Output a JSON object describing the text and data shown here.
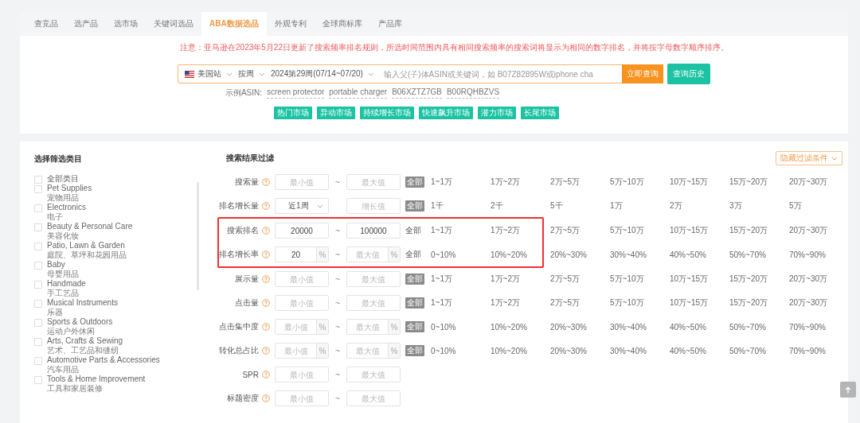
{
  "tabs": [
    {
      "label": "查竞品",
      "selected": false
    },
    {
      "label": "选产品",
      "selected": false
    },
    {
      "label": "选市场",
      "selected": false
    },
    {
      "label": "关键词选品",
      "selected": false
    },
    {
      "label": "ABA数据选品",
      "selected": true
    },
    {
      "label": "外观专利",
      "selected": false
    },
    {
      "label": "全球商标库",
      "selected": false
    },
    {
      "label": "产品库",
      "selected": false
    }
  ],
  "notice": "注意：亚马逊在2023年5月22日更新了搜索频率排名规则，所选时间范围内具有相同搜索频率的搜索词将显示为相同的数字排名，并将按字母数字顺序排序。",
  "search": {
    "site": "美国站",
    "period": "按周",
    "week": "2024第29周(07/14~07/20)",
    "placeholder": "输入父(子)体ASIN或关键词，如 B07Z82895W或iphone cha",
    "button": "立即查询"
  },
  "history_button": "查询历史",
  "examples": {
    "label": "示例ASIN:",
    "items": [
      "screen protector",
      "portable charger",
      "B06XZTZ7GB",
      "B00RQHBZVS"
    ]
  },
  "markets": [
    "热门市场",
    "异动市场",
    "持续增长市场",
    "快速飙升市场",
    "潜力市场",
    "长尾市场"
  ],
  "categories": {
    "title": "选择筛选类目",
    "items": [
      {
        "name": "全部类目",
        "checked": false
      },
      {
        "name": "Pet Supplies",
        "sub": "宠物用品",
        "checked": false
      },
      {
        "name": "Electronics",
        "sub": "电子",
        "checked": false
      },
      {
        "name": "Beauty & Personal Care",
        "sub": "美容化妆",
        "checked": false
      },
      {
        "name": "Patio, Lawn & Garden",
        "sub": "庭院、草坪和花园用品",
        "checked": false
      },
      {
        "name": "Baby",
        "sub": "母婴用品",
        "checked": false
      },
      {
        "name": "Handmade",
        "sub": "手工艺品",
        "checked": false
      },
      {
        "name": "Musical Instruments",
        "sub": "乐器",
        "checked": false
      },
      {
        "name": "Sports & Outdoors",
        "sub": "运动户外休闲",
        "checked": false
      },
      {
        "name": "Arts, Crafts & Sewing",
        "sub": "艺术、工艺品和缝纫",
        "checked": false
      },
      {
        "name": "Automotive Parts & Accessories",
        "sub": "汽车用品",
        "checked": false
      },
      {
        "name": "Tools & Home Improvement",
        "sub": "工具和家居装修",
        "checked": false
      }
    ]
  },
  "filters": {
    "title": "搜索结果过滤",
    "toggle": "隐藏过滤条件",
    "rows": [
      {
        "label": "搜索量",
        "kind": "range",
        "separator": "~",
        "min": {
          "placeholder": "最小值"
        },
        "max": {
          "placeholder": "最大值"
        },
        "all": "全部",
        "all_selected": true,
        "highlighted": false,
        "options": [
          "1~1万",
          "1万~2万",
          "2万~5万",
          "5万~10万",
          "10万~15万",
          "15万~20万",
          "20万~30万"
        ]
      },
      {
        "label": "排名增长量",
        "kind": "select",
        "select": "近1周",
        "max": {
          "placeholder": "增长值"
        },
        "all": "全部",
        "all_selected": true,
        "highlighted": false,
        "options": [
          "1千",
          "2千",
          "5千",
          "1万",
          "2万",
          "3万",
          "5万"
        ]
      },
      {
        "label": "搜索排名",
        "kind": "range",
        "separator": "~",
        "min": {
          "value": "20000"
        },
        "max": {
          "value": "100000"
        },
        "all": "全部",
        "all_selected": false,
        "highlighted": true,
        "options": [
          "1~1万",
          "1万~2万",
          "2万~5万",
          "5万~10万",
          "10万~15万",
          "15万~20万",
          "20万~30万"
        ]
      },
      {
        "label": "排名增长率",
        "kind": "percent",
        "separator": "~",
        "unit": "%",
        "min": {
          "value": "20"
        },
        "max": {
          "placeholder": "最大值"
        },
        "all": "全部",
        "all_selected": false,
        "highlighted": true,
        "options": [
          "0~10%",
          "10%~20%",
          "20%~30%",
          "30%~40%",
          "40%~50%",
          "50%~70%",
          "70%~90%"
        ]
      },
      {
        "label": "展示量",
        "kind": "range",
        "separator": "~",
        "min": {
          "placeholder": "最小值"
        },
        "max": {
          "placeholder": "最大值"
        },
        "all": "全部",
        "all_selected": true,
        "highlighted": false,
        "options": [
          "1~1万",
          "1万~2万",
          "2万~5万",
          "5万~10万",
          "10万~15万",
          "15万~20万",
          "20万~30万"
        ]
      },
      {
        "label": "点击量",
        "kind": "range",
        "separator": "~",
        "min": {
          "placeholder": "最小值"
        },
        "max": {
          "placeholder": "最大值"
        },
        "all": "全部",
        "all_selected": true,
        "highlighted": false,
        "options": [
          "1~1万",
          "1万~2万",
          "2万~5万",
          "5万~10万",
          "10万~15万",
          "15万~20万",
          "20万~30万"
        ]
      },
      {
        "label": "点击集中度",
        "kind": "percent",
        "separator": "~",
        "unit": "%",
        "min": {
          "placeholder": "最小值"
        },
        "max": {
          "placeholder": "最大值"
        },
        "all": "全部",
        "all_selected": true,
        "highlighted": false,
        "options": [
          "0~10%",
          "10%~20%",
          "20%~30%",
          "30%~40%",
          "40%~50%",
          "50%~70%",
          "70%~90%"
        ]
      },
      {
        "label": "转化总占比",
        "kind": "percent",
        "separator": "~",
        "unit": "%",
        "min": {
          "placeholder": "最小值"
        },
        "max": {
          "placeholder": "最大值"
        },
        "all": "全部",
        "all_selected": true,
        "highlighted": false,
        "options": [
          "0~10%",
          "10%~20%",
          "20%~30%",
          "30%~40%",
          "40%~50%",
          "50%~70%",
          "70%~90%"
        ]
      },
      {
        "label": "SPR",
        "kind": "range",
        "separator": "~",
        "min": {
          "placeholder": "最小值"
        },
        "max": {
          "placeholder": "最大值"
        },
        "highlighted": false
      },
      {
        "label": "标题密度",
        "kind": "range",
        "separator": "~",
        "min": {
          "placeholder": "最小值"
        },
        "max": {
          "placeholder": "最大值"
        },
        "highlighted": false
      }
    ]
  }
}
